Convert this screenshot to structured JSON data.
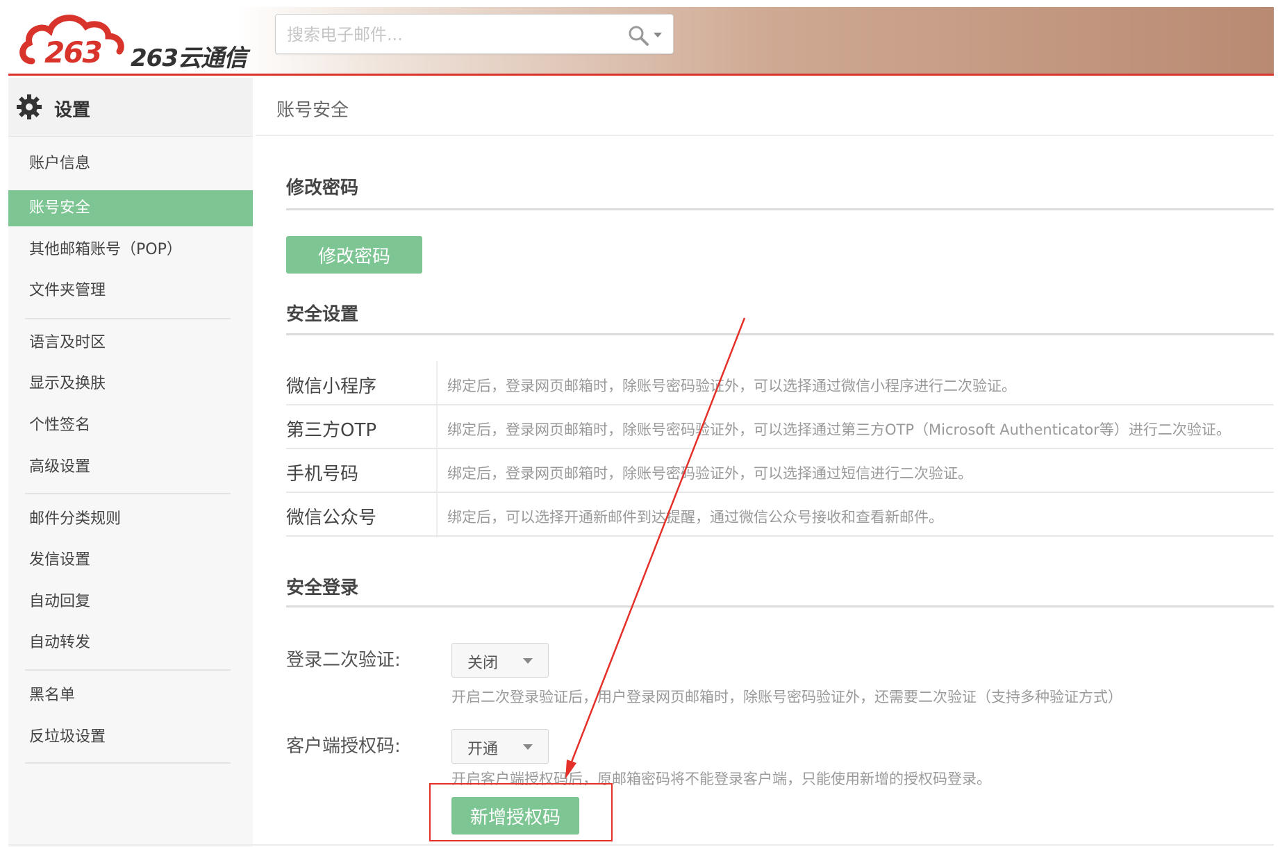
{
  "header": {
    "logo_text": "263云通信",
    "search_placeholder": "搜索电子邮件...",
    "search_icon": "search-icon",
    "brand_color": "#d9342b"
  },
  "sidebar": {
    "title": "设置",
    "title_icon": "gear-icon",
    "items": [
      {
        "label": "账户信息"
      },
      {
        "label": "账号安全",
        "active": true
      },
      {
        "label": "其他邮箱账号（POP）"
      },
      {
        "label": "文件夹管理"
      },
      {
        "label": "语言及时区"
      },
      {
        "label": "显示及换肤"
      },
      {
        "label": "个性签名"
      },
      {
        "label": "高级设置"
      },
      {
        "label": "邮件分类规则"
      },
      {
        "label": "发信设置"
      },
      {
        "label": "自动回复"
      },
      {
        "label": "自动转发"
      },
      {
        "label": "黑名单"
      },
      {
        "label": "反垃圾设置"
      }
    ],
    "active_color": "#7dc593"
  },
  "main": {
    "title": "账号安全",
    "change_password": {
      "section_title": "修改密码",
      "button_label": "修改密码"
    },
    "security_settings": {
      "section_title": "安全设置",
      "rows": [
        {
          "label": "微信小程序",
          "desc": "绑定后，登录网页邮箱时，除账号密码验证外，可以选择通过微信小程序进行二次验证。"
        },
        {
          "label": "第三方OTP",
          "desc": "绑定后，登录网页邮箱时，除账号密码验证外，可以选择通过第三方OTP（Microsoft Authenticator等）进行二次验证。"
        },
        {
          "label": "手机号码",
          "desc": "绑定后，登录网页邮箱时，除账号密码验证外，可以选择通过短信进行二次验证。"
        },
        {
          "label": "微信公众号",
          "desc": "绑定后，可以选择开通新邮件到达提醒，通过微信公众号接收和查看新邮件。"
        }
      ]
    },
    "secure_login": {
      "section_title": "安全登录",
      "two_factor": {
        "label": "登录二次验证:",
        "value": "关闭",
        "hint": "开启二次登录验证后，用户登录网页邮箱时，除账号密码验证外，还需要二次验证（支持多种验证方式）"
      },
      "client_auth": {
        "label": "客户端授权码:",
        "value": "开通",
        "hint": "开启客户端授权码后，原邮箱密码将不能登录客户端，只能使用新增的授权码登录。"
      },
      "add_auth_code_button": "新增授权码"
    },
    "button_color": "#7dc593",
    "annotation_color": "#e5302a"
  }
}
